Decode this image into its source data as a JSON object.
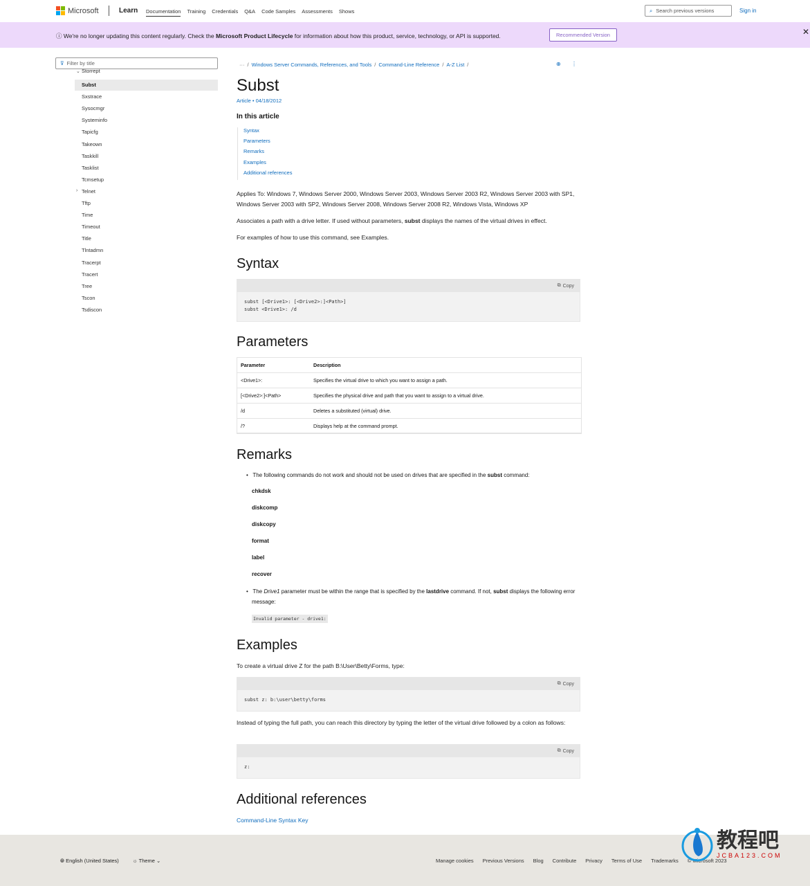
{
  "header": {
    "brand": "Microsoft",
    "product": "Learn",
    "nav": [
      "Documentation",
      "Training",
      "Credentials",
      "Q&A",
      "Code Samples",
      "Assessments",
      "Shows"
    ],
    "search_placeholder": "Search previous versions",
    "sign_in": "Sign in"
  },
  "banner": {
    "text_pre": "We're no longer updating this content regularly. Check the ",
    "link": "Microsoft Product Lifecycle",
    "text_post": " for information about how this product, service, technology, or API is supported.",
    "button": "Recommended Version",
    "close": "✕"
  },
  "sidebar": {
    "filter_placeholder": "Filter by title",
    "items": [
      "Storrept",
      "Subst",
      "Sxstrace",
      "Sysocmgr",
      "Systeminfo",
      "Tapicfg",
      "Takeown",
      "Taskkill",
      "Tasklist",
      "Tcmsetup",
      "Telnet",
      "Tftp",
      "Time",
      "Timeout",
      "Title",
      "Tlntadmn",
      "Tracerpt",
      "Tracert",
      "Tree",
      "Tscon",
      "Tsdiscon"
    ],
    "selected": "Subst"
  },
  "breadcrumb": {
    "ellipsis": "···",
    "items": [
      "Windows Server Commands, References, and Tools",
      "Command-Line Reference",
      "A-Z List"
    ]
  },
  "article": {
    "title": "Subst",
    "meta": "Article • 04/18/2012",
    "toc_title": "In this article",
    "toc": [
      "Syntax",
      "Parameters",
      "Remarks",
      "Examples",
      "Additional references"
    ],
    "applies": "Applies To: Windows 7, Windows Server 2000, Windows Server 2003, Windows Server 2003 R2, Windows Server 2003 with SP1, Windows Server 2003 with SP2, Windows Server 2008, Windows Server 2008 R2, Windows Vista, Windows XP",
    "desc_pre": "Associates a path with a drive letter. If used without parameters, ",
    "desc_bold": "subst",
    "desc_post": " displays the names of the virtual drives in effect.",
    "examples_ref": "For examples of how to use this command, see Examples.",
    "syntax_heading": "Syntax",
    "copy": "Copy",
    "syntax_code": "subst [<Drive1>: [<Drive2>:]<Path>]\nsubst <Drive1>: /d",
    "params_heading": "Parameters",
    "table_headers": [
      "Parameter",
      "Description"
    ],
    "params": [
      [
        "<Drive1>:",
        "Specifies the virtual drive to which you want to assign a path."
      ],
      [
        "[<Drive2>:]<Path>",
        "Specifies the physical drive and path that you want to assign to a virtual drive."
      ],
      [
        "/d",
        "Deletes a substituted (virtual) drive."
      ],
      [
        "/?",
        "Displays help at the command prompt."
      ]
    ],
    "remarks_heading": "Remarks",
    "remark1_pre": "The following commands do not work and should not be used on drives that are specified in the ",
    "remark1_bold": "subst",
    "remark1_post": " command:",
    "commands": [
      "chkdsk",
      "diskcomp",
      "diskcopy",
      "format",
      "label",
      "recover"
    ],
    "remark2": {
      "a": "The ",
      "b": "Drive1",
      "c": " parameter must be within the range that is specified by the ",
      "d": "lastdrive",
      "e": " command. If not, ",
      "f": "subst",
      "g": " displays the following error message:"
    },
    "error_msg": "Invalid parameter - drive1:",
    "examples_heading": "Examples",
    "ex1_text": "To create a virtual drive Z for the path B:\\User\\Betty\\Forms, type:",
    "ex1_code": "subst z: b:\\user\\betty\\forms",
    "ex2_text": "Instead of typing the full path, you can reach this directory by typing the letter of the virtual drive followed by a colon as follows:",
    "ex2_code": "z:",
    "addref_heading": "Additional references",
    "addref_link": "Command-Line Syntax Key"
  },
  "footer": {
    "language": "English (United States)",
    "theme": "Theme",
    "links": [
      "Manage cookies",
      "Previous Versions",
      "Blog",
      "Contribute",
      "Privacy",
      "Terms of Use",
      "Trademarks",
      "© Microsoft 2023"
    ]
  },
  "watermark": {
    "text": "教程吧",
    "url": "JCBA123.COM"
  },
  "colors": {
    "link": "#0f6cbd",
    "banner": "#edd9fb",
    "accent": "#8661c5",
    "footer": "#e8e6e1"
  }
}
